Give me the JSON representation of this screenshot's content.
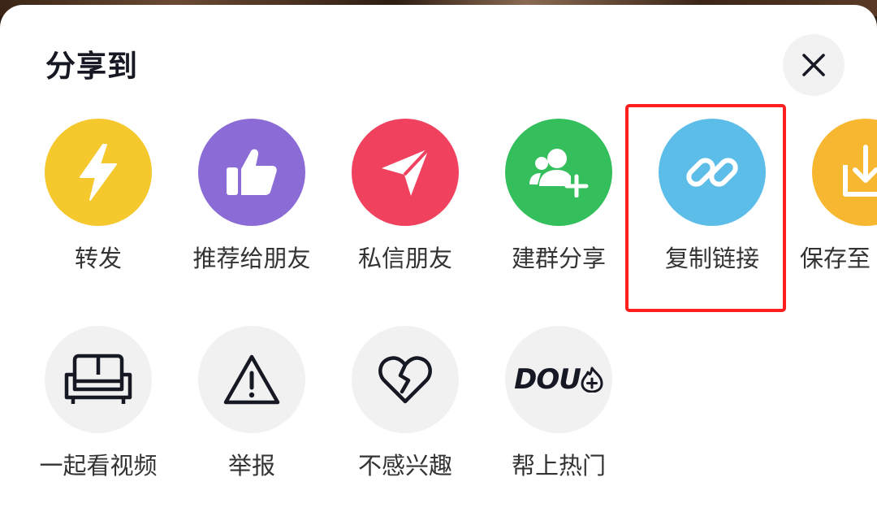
{
  "sheet": {
    "title": "分享到"
  },
  "share_row": [
    {
      "label": "转发",
      "icon": "lightning-icon",
      "color": "#f5c82e"
    },
    {
      "label": "推荐给朋友",
      "icon": "thumbs-up-icon",
      "color": "#8b6bd6"
    },
    {
      "label": "私信朋友",
      "icon": "paper-plane-icon",
      "color": "#f0415e"
    },
    {
      "label": "建群分享",
      "icon": "add-group-icon",
      "color": "#35bf5c"
    },
    {
      "label": "复制链接",
      "icon": "link-icon",
      "color": "#5dbde9"
    },
    {
      "label": "保存至",
      "icon": "download-icon",
      "color": "#f7b731"
    }
  ],
  "action_row": [
    {
      "label": "一起看视频",
      "icon": "sofa-icon"
    },
    {
      "label": "举报",
      "icon": "warning-icon"
    },
    {
      "label": "不感兴趣",
      "icon": "broken-heart-icon"
    },
    {
      "label": "帮上热门",
      "icon": "dou-plus-icon"
    }
  ],
  "dou_logo_text": "DOU",
  "highlight_color": "#ff1f1f"
}
